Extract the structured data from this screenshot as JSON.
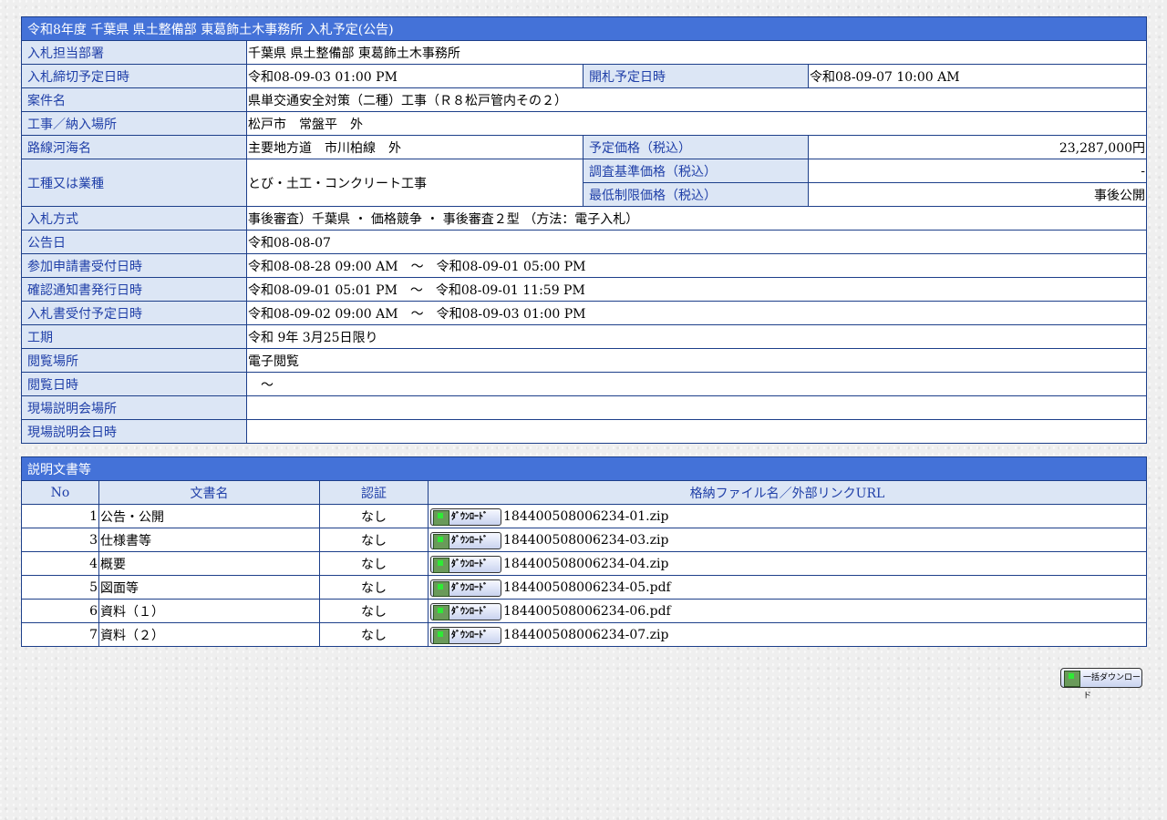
{
  "main": {
    "title": "令和8年度 千葉県 県土整備部 東葛飾土木事務所 入札予定(公告)",
    "rows": {
      "dept_label": "入札担当部署",
      "dept_value": "千葉県 県土整備部 東葛飾土木事務所",
      "deadline_label": "入札締切予定日時",
      "deadline_value": "令和08-09-03 01:00 PM",
      "opening_label": "開札予定日時",
      "opening_value": "令和08-09-07 10:00 AM",
      "case_label": "案件名",
      "case_value": "県単交通安全対策（二種）工事（Ｒ８松戸管内その２）",
      "place_label": "工事／納入場所",
      "place_value": "松戸市　常盤平　外",
      "route_label": "路線河海名",
      "route_value": "主要地方道　市川柏線　外",
      "price_label": "予定価格（税込）",
      "price_value": "23,287,000円",
      "type_label": "工種又は業種",
      "type_value": "とび・土工・コンクリート工事",
      "survey_label": "調査基準価格（税込）",
      "survey_value": "-",
      "minimum_label": "最低制限価格（税込）",
      "minimum_value": "事後公開",
      "method_label": "入札方式",
      "method_value": "事後審査）千葉県 ・ 価格競争 ・ 事後審査２型 （方法：電子入札）",
      "notice_label": "公告日",
      "notice_value": "令和08-08-07",
      "apply_label": "参加申請書受付日時",
      "apply_value": "令和08-08-28 09:00 AM　～　令和08-09-01 05:00 PM",
      "confirm_label": "確認通知書発行日時",
      "confirm_value": "令和08-09-01 05:01 PM　～　令和08-09-01 11:59 PM",
      "bid_label": "入札書受付予定日時",
      "bid_value": "令和08-09-02 09:00 AM　～　令和08-09-03 01:00 PM",
      "period_label": "工期",
      "period_value": "令和 9年 3月25日限り",
      "view_place_label": "閲覧場所",
      "view_place_value": "電子閲覧",
      "view_date_label": "閲覧日時",
      "view_date_value": "　～",
      "site_place_label": "現場説明会場所",
      "site_place_value": "",
      "site_date_label": "現場説明会日時",
      "site_date_value": ""
    }
  },
  "docs": {
    "title": "説明文書等",
    "headers": {
      "no": "No",
      "name": "文書名",
      "auth": "認証",
      "file": "格納ファイル名／外部リンクURL"
    },
    "download_label": "ﾀﾞｳﾝﾛｰﾄﾞ",
    "rows": [
      {
        "no": "1",
        "name": "公告・公開",
        "auth": "なし",
        "file": "184400508006234-01.zip"
      },
      {
        "no": "3",
        "name": "仕様書等",
        "auth": "なし",
        "file": "184400508006234-03.zip"
      },
      {
        "no": "4",
        "name": "概要",
        "auth": "なし",
        "file": "184400508006234-04.zip"
      },
      {
        "no": "5",
        "name": "図面等",
        "auth": "なし",
        "file": "184400508006234-05.pdf"
      },
      {
        "no": "6",
        "name": "資料（１）",
        "auth": "なし",
        "file": "184400508006234-06.pdf"
      },
      {
        "no": "7",
        "name": "資料（２）",
        "auth": "なし",
        "file": "184400508006234-07.zip"
      }
    ]
  },
  "bulk_download_label": "一括ダウンロード",
  "icons": {
    "download": "download-icon"
  },
  "colors": {
    "header": "#4472d8",
    "label_bg": "#dce6f5",
    "label_text": "#1f3fa8",
    "border": "#1d3f8a"
  }
}
